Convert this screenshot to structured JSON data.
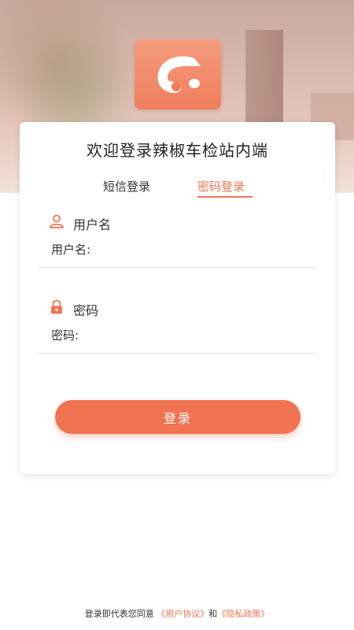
{
  "login": {
    "title": "欢迎登录辣椒车检站内端",
    "tabs": [
      {
        "label": "短信登录",
        "active": false
      },
      {
        "label": "密码登录",
        "active": true
      }
    ],
    "username": {
      "label": "用户名",
      "placeholder": "用户名:",
      "icon": "user-icon"
    },
    "password": {
      "label": "密码",
      "placeholder": "密码:",
      "icon": "lock-icon"
    },
    "submit_label": "登录"
  },
  "footer": {
    "prefix": "登录即代表您同意",
    "terms_link": "《用户协议》",
    "conjunction": "和",
    "privacy_link": "《隐私政策》"
  },
  "colors": {
    "accent": "#f07452",
    "logo_top": "#f59c7e",
    "logo_bottom": "#f07e5c"
  }
}
